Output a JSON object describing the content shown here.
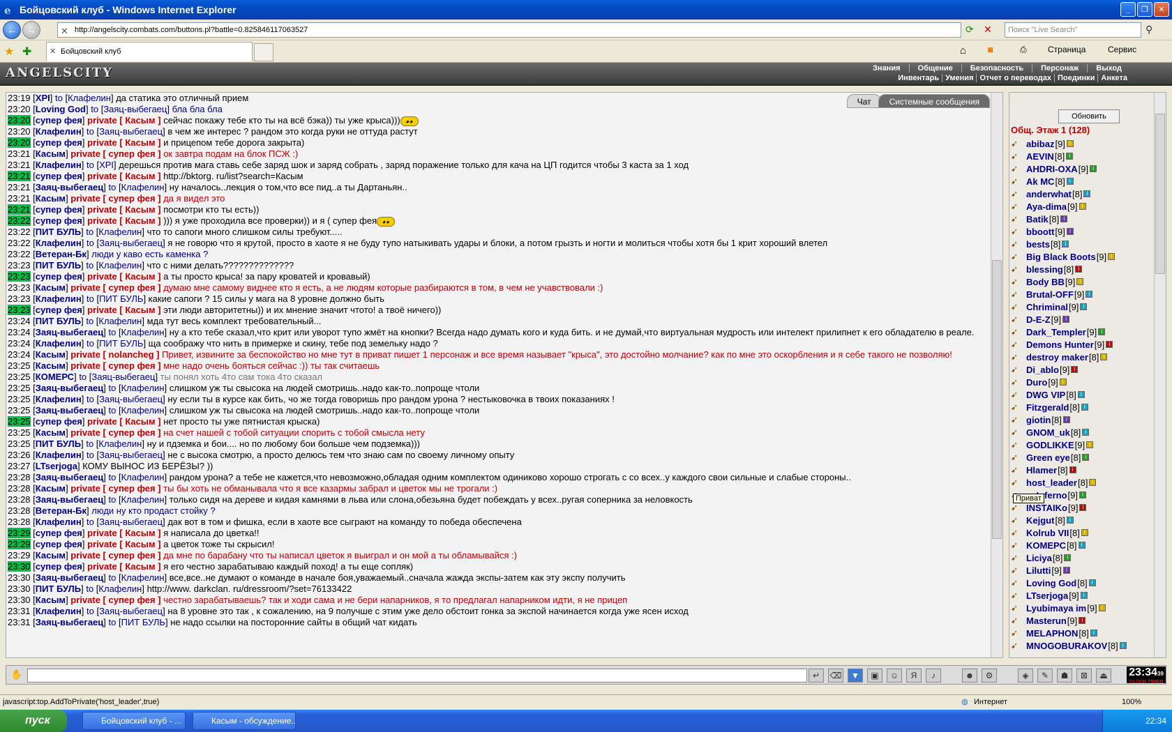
{
  "window": {
    "title": "Бойцовский клуб - Windows Internet Explorer"
  },
  "browser": {
    "url": "http://angelscity.combats.com/buttons.pl?battle=0.825846117063527",
    "search_placeholder": "Поиск \"Live Search\"",
    "tab_title": "Бойцовский клуб",
    "page_menu": "Страница",
    "tools_menu": "Сервис"
  },
  "game": {
    "logo": "ANGELSCITY",
    "menu_top": [
      "Знания",
      "Общение",
      "Безопасность",
      "Персонаж",
      "Выход"
    ],
    "menu_bottom": [
      "Инвентарь",
      "Умения",
      "Отчет о переводах",
      "Поединки",
      "Анкета"
    ]
  },
  "chat": {
    "tabs": [
      "Чат",
      "Системные сообщения"
    ],
    "messages": [
      {
        "t": "23:19",
        "hl": false,
        "from": "XPI",
        "kind": "to",
        "target": "Клафелин",
        "text": "да статика это отличный прием"
      },
      {
        "t": "23:20",
        "hl": false,
        "from": "Loving God",
        "kind": "to",
        "target": "Заяц-выбегаец",
        "text": "бла бла бла",
        "cls": "blue"
      },
      {
        "t": "23:20",
        "hl": true,
        "from": "супер фея",
        "kind": "private",
        "target": "Касым",
        "text": "сейчас покажу тебе кто ты на всё бэка)) ты уже крыса)))",
        "smile": true
      },
      {
        "t": "23:20",
        "hl": false,
        "from": "Клафелин",
        "kind": "to",
        "target": "Заяц-выбегаец",
        "text": "в чем же интерес ? рандом это когда руки не оттуда растут"
      },
      {
        "t": "23:20",
        "hl": true,
        "from": "супер фея",
        "kind": "private",
        "target": "Касым",
        "text": "и прицепом тебе дорога закрыта)"
      },
      {
        "t": "23:21",
        "hl": false,
        "from": "Касым",
        "kind": "private",
        "target": "супер фея",
        "text": "ок завтра подам на блок ПСЖ :)",
        "cls": "red"
      },
      {
        "t": "23:21",
        "hl": false,
        "from": "Клафелин",
        "kind": "to",
        "target": "XPI",
        "text": "дерешься против мага ставь себе заряд шок и заряд собрать , заряд поражение только для кача на ЦП годится чтобы 3 каста за 1 ход"
      },
      {
        "t": "23:21",
        "hl": true,
        "from": "супер фея",
        "kind": "private",
        "target": "Касым",
        "text": "http://bktorg. ru/list?search=Касым"
      },
      {
        "t": "23:21",
        "hl": false,
        "from": "Заяц-выбегаец",
        "kind": "to",
        "target": "Клафелин",
        "text": "ну началось..лекция о том,что все пид..а ты Дартаньян.."
      },
      {
        "t": "23:21",
        "hl": false,
        "from": "Касым",
        "kind": "private",
        "target": "супер фея",
        "text": "да я видел это",
        "cls": "red"
      },
      {
        "t": "23:21",
        "hl": true,
        "from": "супер фея",
        "kind": "private",
        "target": "Касым",
        "text": "посмотри кто ты есть))"
      },
      {
        "t": "23:22",
        "hl": true,
        "from": "супер фея",
        "kind": "private",
        "target": "Касым",
        "text": "))) я уже проходила все проверки)) и я ( супер фея",
        "smile": true
      },
      {
        "t": "23:22",
        "hl": false,
        "from": "ПИТ БУЛЬ",
        "kind": "to",
        "target": "Клафелин",
        "text": "что то сапоги много слишком силы требуют....."
      },
      {
        "t": "23:22",
        "hl": false,
        "from": "Клафелин",
        "kind": "to",
        "target": "Заяц-выбегаец",
        "text": "я не говорю что я крутой, просто в хаоте я не буду тупо натыкивать удары и блоки, а потом грызть и ногти и молиться чтобы хотя бы 1 крит хороший влетел"
      },
      {
        "t": "23:22",
        "hl": false,
        "from": "Ветеран-Бк",
        "kind": "none",
        "target": "",
        "text": "люди у каво есть каменка ?",
        "cls": "blue"
      },
      {
        "t": "23:23",
        "hl": false,
        "from": "ПИТ БУЛЬ",
        "kind": "to",
        "target": "Клафелин",
        "text": "что с ними делать??????????????"
      },
      {
        "t": "23:23",
        "hl": true,
        "from": "супер фея",
        "kind": "private",
        "target": "Касым",
        "text": "а ты просто крыса! за пару кроватей и кровавый)"
      },
      {
        "t": "23:23",
        "hl": false,
        "from": "Касым",
        "kind": "private",
        "target": "супер фея",
        "text": "думаю мне самому виднее кто я есть, а не людям которые разбираются в том, в чем не учавствовали :)",
        "cls": "red"
      },
      {
        "t": "23:23",
        "hl": false,
        "from": "Клафелин",
        "kind": "to",
        "target": "ПИТ БУЛЬ",
        "text": "какие сапоги ? 15 силы у мага на 8 уровне должно быть"
      },
      {
        "t": "23:23",
        "hl": true,
        "from": "супер фея",
        "kind": "private",
        "target": "Касым",
        "text": "эти люди авторитетны)) и их мнение значит чтото! а твоё ничего))"
      },
      {
        "t": "23:24",
        "hl": false,
        "from": "ПИТ БУЛЬ",
        "kind": "to",
        "target": "Клафелин",
        "text": "мда тут весь комплект требовательный..."
      },
      {
        "t": "23:24",
        "hl": false,
        "from": "Заяц-выбегаец",
        "kind": "to",
        "target": "Клафелин",
        "text": "ну а кто тебе сказал,что крит или уворот тупо жмёт на кнопки? Всегда надо думать кого и куда бить. и не думай,что виртуальная мудрость или интелект прилипнет к его обладателю в реале.",
        "wrap": true
      },
      {
        "t": "23:24",
        "hl": false,
        "from": "Клафелин",
        "kind": "to",
        "target": "ПИТ БУЛЬ",
        "text": "ща соображу что нить в примерке и скину, тебе под земельку надо ?"
      },
      {
        "t": "23:24",
        "hl": false,
        "from": "Касым",
        "kind": "private",
        "target": "nolancheg",
        "text": "Привет, извините за беспокойство но мне тут в приват пишет 1 персонаж и все время называет \"крыса\", это достойно молчание? как по мне это оскорбления и я себе такого не позволяю!",
        "cls": "red",
        "wrap": true
      },
      {
        "t": "23:25",
        "hl": false,
        "from": "Касым",
        "kind": "private",
        "target": "супер фея",
        "text": "мне надо очень бояться сейчас :)) ты так считаешь",
        "cls": "red"
      },
      {
        "t": "23:25",
        "hl": false,
        "from": "КОМЕРС",
        "kind": "to",
        "target": "Заяц-выбегаец",
        "text": "ты понял хоть 4то сам тока 4то сказал",
        "cls": "gray"
      },
      {
        "t": "23:25",
        "hl": false,
        "from": "Заяц-выбегаец",
        "kind": "to",
        "target": "Клафелин",
        "text": "слишком уж ты свысока на людей смотришь..надо как-то..попроще чтоли"
      },
      {
        "t": "23:25",
        "hl": false,
        "from": "Клафелин",
        "kind": "to",
        "target": "Заяц-выбегаец",
        "text": "ну если ты в курсе как бить, чо же тогда говоришь про рандом урона ? нестыковочка в твоих показаниях !"
      },
      {
        "t": "23:25",
        "hl": false,
        "from": "Заяц-выбегаец",
        "kind": "to",
        "target": "Клафелин",
        "text": "слишком уж ты свысока на людей смотришь..надо как-то..попроще чтоли"
      },
      {
        "t": "23:25",
        "hl": true,
        "from": "супер фея",
        "kind": "private",
        "target": "Касым",
        "text": "нет просто ты уже пятнистая крыска)"
      },
      {
        "t": "23:25",
        "hl": false,
        "from": "Касым",
        "kind": "private",
        "target": "супер фея",
        "text": "на счет нашей с тобой ситуации спорить с тобой смысла нету",
        "cls": "red"
      },
      {
        "t": "23:25",
        "hl": false,
        "from": "ПИТ БУЛЬ",
        "kind": "to",
        "target": "Клафелин",
        "text": "ну и пдземка и бои.... но по любому бои больше чем подземка)))"
      },
      {
        "t": "23:26",
        "hl": false,
        "from": "Клафелин",
        "kind": "to",
        "target": "Заяц-выбегаец",
        "text": "не с высока смотрю, а просто делюсь тем что знаю сам по своему личному опыту"
      },
      {
        "t": "23:27",
        "hl": false,
        "from": "LTserjoga",
        "kind": "none",
        "target": "",
        "text": "КОМУ ВЫНОС ИЗ БЕРЁЗЫ? ))"
      },
      {
        "t": "23:28",
        "hl": false,
        "from": "Заяц-выбегаец",
        "kind": "to",
        "target": "Клафелин",
        "text": "рандом урона? а тебе не кажется,что невозможно,обладая одним комплектом одиниково хорошо строгать с со всех..у каждого свои сильные и слабые стороны.."
      },
      {
        "t": "23:28",
        "hl": false,
        "from": "Касым",
        "kind": "private",
        "target": "супер фея",
        "text": "ты бы хоть не обманывала что я все казармы забрал и цветок мы не трогали :)",
        "cls": "red"
      },
      {
        "t": "23:28",
        "hl": false,
        "from": "Заяц-выбегаец",
        "kind": "to",
        "target": "Клафелин",
        "text": "только сидя на дереве и кидая камнями в льва или слона,обезьяна будет побеждать у всех..ругая соперника за неловкость"
      },
      {
        "t": "23:28",
        "hl": false,
        "from": "Ветеран-Бк",
        "kind": "none",
        "target": "",
        "text": "люди ну кто продаст стойку ?",
        "cls": "blue"
      },
      {
        "t": "23:28",
        "hl": false,
        "from": "Клафелин",
        "kind": "to",
        "target": "Заяц-выбегаец",
        "text": "дак вот в том и фишка, если в хаоте все сыграют на команду то победа обеспечена"
      },
      {
        "t": "23:29",
        "hl": true,
        "from": "супер фея",
        "kind": "private",
        "target": "Касым",
        "text": "я написала до цветка!!"
      },
      {
        "t": "23:29",
        "hl": true,
        "from": "супер фея",
        "kind": "private",
        "target": "Касым",
        "text": "а цветок тоже ты скрысил!"
      },
      {
        "t": "23:29",
        "hl": false,
        "from": "Касым",
        "kind": "private",
        "target": "супер фея",
        "text": "да мне по барабану что ты написал цветок я выиграл и он мой а ты обламывайся :)",
        "cls": "red"
      },
      {
        "t": "23:30",
        "hl": true,
        "from": "супер фея",
        "kind": "private",
        "target": "Касым",
        "text": "я его честно зарабатываю каждый поход! а ты еще сопляк)"
      },
      {
        "t": "23:30",
        "hl": false,
        "from": "Заяц-выбегаец",
        "kind": "to",
        "target": "Клафелин",
        "text": "все,все..не думают о команде в начале боя,уважаемый..сначала жажда экспы-затем как эту экспу получить"
      },
      {
        "t": "23:30",
        "hl": false,
        "from": "ПИТ БУЛЬ",
        "kind": "to",
        "target": "Клафелин",
        "text": "http://www. darkclan. ru/dressroom/?set=76133422"
      },
      {
        "t": "23:30",
        "hl": false,
        "from": "Касым",
        "kind": "private",
        "target": "супер фея",
        "text": "честно зарабатываешь? так и ходи сама и не бери напарников, я то предлагал напарником идти, я не прицеп",
        "cls": "red"
      },
      {
        "t": "23:31",
        "hl": false,
        "from": "Клафелин",
        "kind": "to",
        "target": "Заяц-выбегаец",
        "text": "на 8 уровне это так , к сожалению, на 9 получше с этим уже дело обстоит гонка за экспой начинается когда уже ясен исход"
      },
      {
        "t": "23:31",
        "hl": false,
        "from": "Заяц-выбегаец",
        "kind": "to",
        "target": "ПИТ БУЛЬ",
        "text": "не надо ссылки на посторонние сайты в общий чат кидать"
      }
    ],
    "private_word": "private",
    "to_word": "to"
  },
  "sidebar": {
    "refresh_label": "Обновить",
    "floor_label": "Общ. Этаж 1 (128)",
    "tooltip": "Приват",
    "users": [
      {
        "name": "abibaz",
        "lvl": "[9]",
        "c": "#d4b000"
      },
      {
        "name": "AEVIN",
        "lvl": "[8]",
        "c": "#2a9a2a"
      },
      {
        "name": "AHDRI-OXA",
        "lvl": "[9]",
        "c": "#2a9a2a"
      },
      {
        "name": "Ak MC",
        "lvl": "[8]",
        "c": "#1aa0c0"
      },
      {
        "name": "anderwhat",
        "lvl": "[8]",
        "c": "#1aa0c0"
      },
      {
        "name": "Aya-dima",
        "lvl": "[9]",
        "c": "#d4b000"
      },
      {
        "name": "Batik",
        "lvl": "[8]",
        "c": "#6a3aa0"
      },
      {
        "name": "bboott",
        "lvl": "[9]",
        "c": "#6a3aa0"
      },
      {
        "name": "bests",
        "lvl": "[8]",
        "c": "#1aa0c0"
      },
      {
        "name": "Big Black Boots",
        "lvl": "[9]",
        "c": "#d4b000"
      },
      {
        "name": "blessing",
        "lvl": "[8]",
        "c": "#b01010"
      },
      {
        "name": "Body BB",
        "lvl": "[9]",
        "c": "#d4b000"
      },
      {
        "name": "Brutal-OFF",
        "lvl": "[9]",
        "c": "#1aa0c0"
      },
      {
        "name": "Chriminal",
        "lvl": "[9]",
        "c": "#1aa0c0"
      },
      {
        "name": "D-E-Z",
        "lvl": "[9]",
        "c": "#6a3aa0"
      },
      {
        "name": "Dark_Templer",
        "lvl": "[9]",
        "c": "#2a9a2a"
      },
      {
        "name": "Demons Hunter",
        "lvl": "[9]",
        "c": "#b01010"
      },
      {
        "name": "destroy maker",
        "lvl": "[8]",
        "c": "#d4b000"
      },
      {
        "name": "Di_ablo",
        "lvl": "[9]",
        "c": "#b01010"
      },
      {
        "name": "Duro",
        "lvl": "[9]",
        "c": "#d4b000"
      },
      {
        "name": "DWG VIP",
        "lvl": "[8]",
        "c": "#1aa0c0"
      },
      {
        "name": "Fitzgerald",
        "lvl": "[8]",
        "c": "#1aa0c0"
      },
      {
        "name": "giotin",
        "lvl": "[8]",
        "c": "#6a3aa0"
      },
      {
        "name": "GNOM_uk",
        "lvl": "[8]",
        "c": "#1aa0c0"
      },
      {
        "name": "GODLIKKE",
        "lvl": "[9]",
        "c": "#d4b000"
      },
      {
        "name": "Green eye",
        "lvl": "[8]",
        "c": "#2a9a2a"
      },
      {
        "name": "Hlamer",
        "lvl": "[8]",
        "c": "#b01010"
      },
      {
        "name": "host_leader",
        "lvl": "[8]",
        "c": "#d4b000"
      },
      {
        "name": "e_Inferno",
        "lvl": "[9]",
        "c": "#2a9a2a"
      },
      {
        "name": "INSTAIKo",
        "lvl": "[9]",
        "c": "#b01010"
      },
      {
        "name": "Kejgut",
        "lvl": "[8]",
        "c": "#1aa0c0"
      },
      {
        "name": "Kolrub VII",
        "lvl": "[8]",
        "c": "#d4b000"
      },
      {
        "name": "KOMEPC",
        "lvl": "[8]",
        "c": "#1aa0c0"
      },
      {
        "name": "Liciya",
        "lvl": "[8]",
        "c": "#2a9a2a"
      },
      {
        "name": "Lilutti",
        "lvl": "[9]",
        "c": "#6a3aa0"
      },
      {
        "name": "Loving God",
        "lvl": "[8]",
        "c": "#1aa0c0"
      },
      {
        "name": "LTserjoga",
        "lvl": "[9]",
        "c": "#1aa0c0"
      },
      {
        "name": "Lyubimaya im",
        "lvl": "[9]",
        "c": "#d4b000"
      },
      {
        "name": "Masterun",
        "lvl": "[9]",
        "c": "#b01010"
      },
      {
        "name": "MELAPHON",
        "lvl": "[8]",
        "c": "#1aa0c0"
      },
      {
        "name": "MNOGOBURAKOV",
        "lvl": "[8]",
        "c": "#1aa0c0"
      }
    ]
  },
  "inputbar": {
    "clock": "23:34",
    "clock_sec": "39",
    "clock_sub": "CLOCK TIMER"
  },
  "status": {
    "left": "javascript:top.AddToPrivate('host_leader',true)",
    "zone": "Интернет",
    "zoom": "100%"
  },
  "taskbar": {
    "start": "пуск",
    "tasks": [
      "Бойцовский клуб - ...",
      "Касым - обсуждение..."
    ],
    "time": "22:34"
  }
}
